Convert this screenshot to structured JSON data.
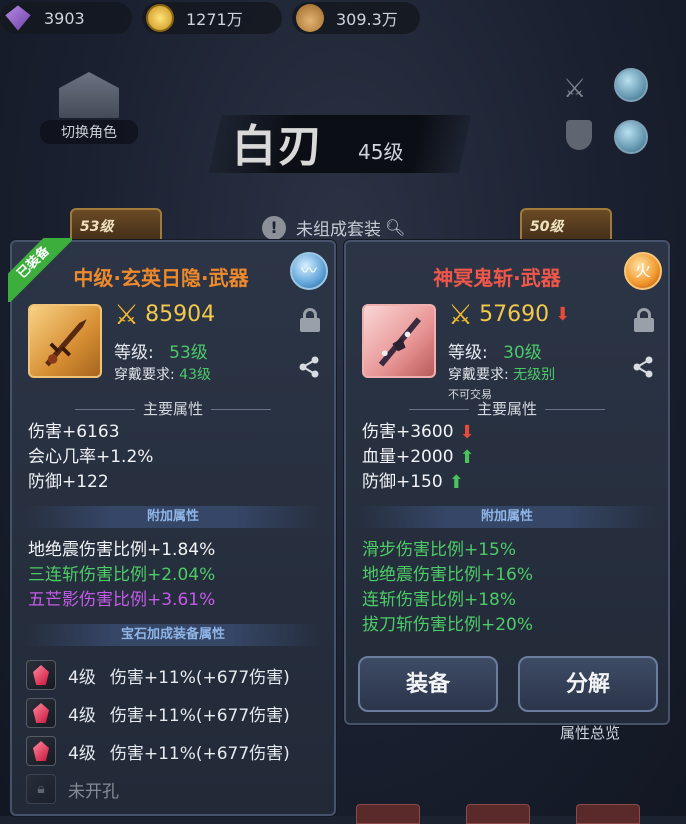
{
  "currency": {
    "gems": "3903",
    "gold": "1271万",
    "bag": "309.3万"
  },
  "switch_role": {
    "label": "切换角色"
  },
  "weapon": {
    "name": "白刃",
    "level": "45级"
  },
  "set_bar": {
    "label": "未组成套装"
  },
  "bg_slots": {
    "left": "53级",
    "right": "50级"
  },
  "left_card": {
    "tag": "已装备",
    "title": "中级·玄英日隐·武器",
    "power": "85904",
    "level_label": "等级:",
    "level_value": "53级",
    "req_label": "穿戴要求:",
    "req_value": "43级",
    "main_attr_title": "主要属性",
    "main_attrs": [
      "伤害+6163",
      "会心几率+1.2%",
      "防御+122"
    ],
    "extra_attr_title": "附加属性",
    "extra_attrs": [
      "地绝震伤害比例+1.84%",
      "三连斩伤害比例+2.04%",
      "五芒影伤害比例+3.61%"
    ],
    "gem_attr_title": "宝石加成装备属性",
    "gems": [
      {
        "level": "4级",
        "text": "伤害+11%(+677伤害)"
      },
      {
        "level": "4级",
        "text": "伤害+11%(+677伤害)"
      },
      {
        "level": "4级",
        "text": "伤害+11%(+677伤害)"
      }
    ],
    "unopened": "未开孔"
  },
  "right_card": {
    "title": "神冥鬼斩·武器",
    "power": "57690",
    "level_label": "等级:",
    "level_value": "30级",
    "req_label": "穿戴要求:",
    "req_value": "无级别",
    "trade": "不可交易",
    "main_attr_title": "主要属性",
    "main_attrs": [
      {
        "text": "伤害+3600",
        "trend": "down"
      },
      {
        "text": "血量+2000",
        "trend": "up"
      },
      {
        "text": "防御+150",
        "trend": "up"
      }
    ],
    "extra_attr_title": "附加属性",
    "extra_attrs": [
      "滑步伤害比例+15%",
      "地绝震伤害比例+16%",
      "连斩伤害比例+18%",
      "拔刀斩伤害比例+20%"
    ],
    "btn_equip": "装备",
    "btn_decompose": "分解"
  },
  "overview": {
    "label": "属性总览"
  },
  "colors": {
    "green": "#4dcb66",
    "purple": "#c45be8",
    "orange": "#ee8a2c",
    "red": "#f0574a",
    "gold": "#f2c94c"
  }
}
